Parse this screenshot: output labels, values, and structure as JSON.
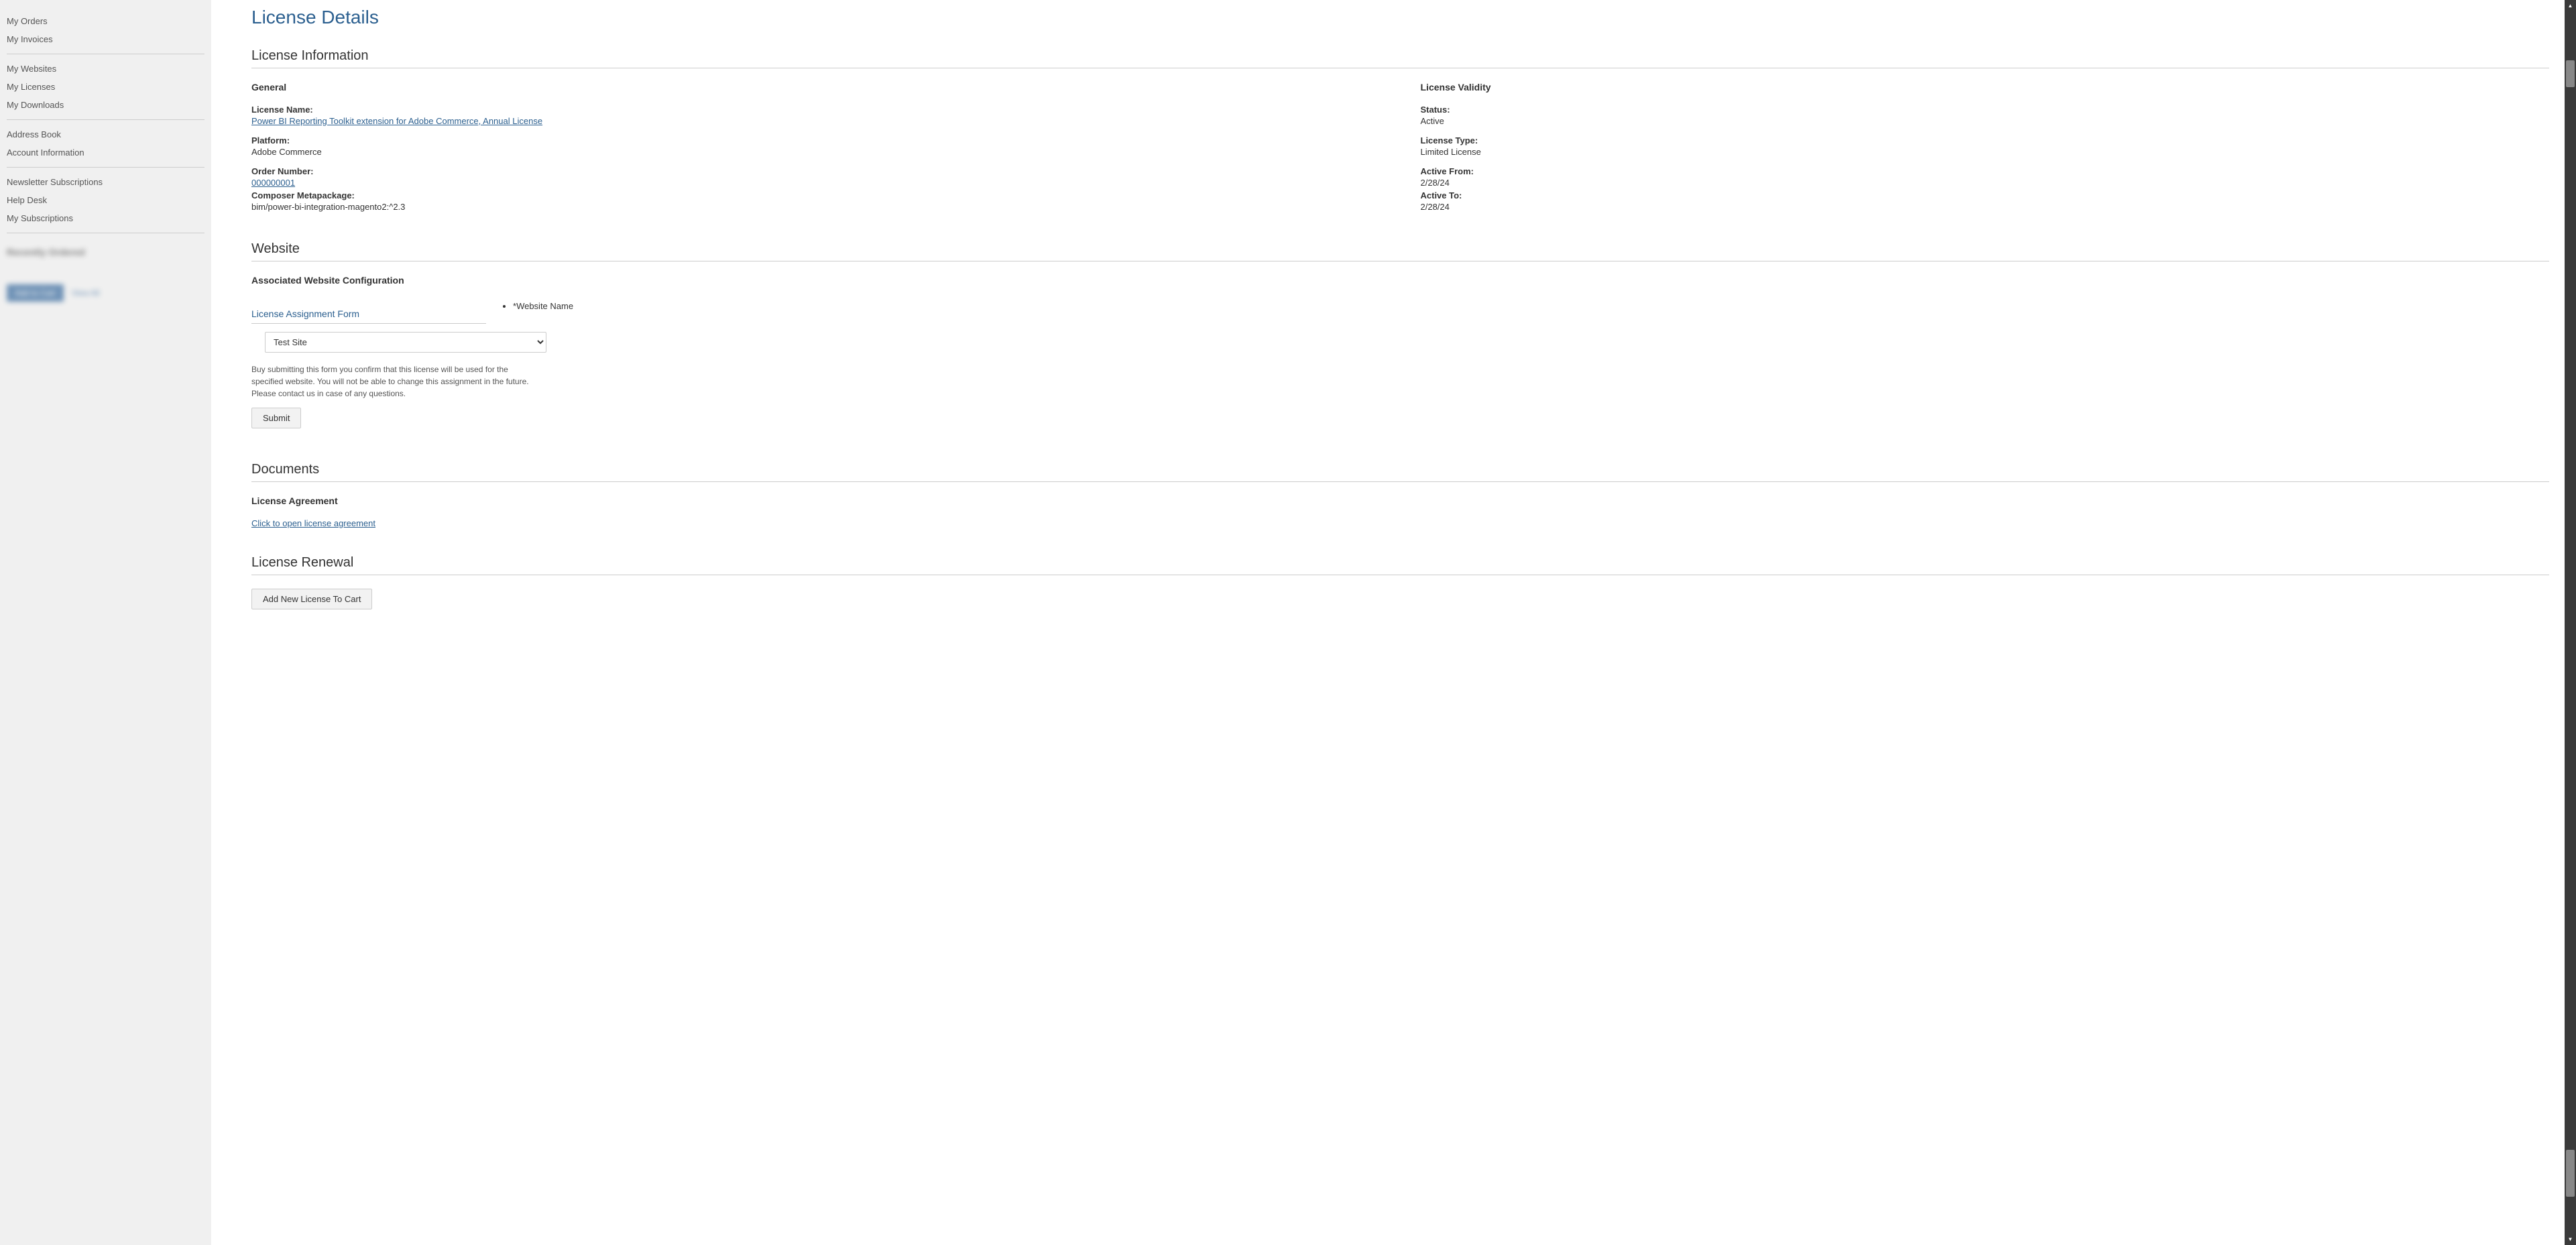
{
  "sidebar": {
    "groups": [
      {
        "items": [
          "My Orders",
          "My Invoices"
        ]
      },
      {
        "items": [
          "My Websites",
          "My Licenses",
          "My Downloads"
        ]
      },
      {
        "items": [
          "Address Book",
          "Account Information"
        ]
      },
      {
        "items": [
          "Newsletter Subscriptions",
          "Help Desk",
          "My Subscriptions"
        ]
      }
    ],
    "blurred": {
      "heading": "Recently Ordered",
      "button": "Add to Cart",
      "link": "View All"
    }
  },
  "page": {
    "title": "License Details"
  },
  "licenseInfo": {
    "sectionTitle": "License Information",
    "general": {
      "heading": "General",
      "licenseNameLabel": "License Name:",
      "licenseName": "Power BI Reporting Toolkit extension for Adobe Commerce, Annual License",
      "platformLabel": "Platform:",
      "platform": "Adobe Commerce",
      "orderNumberLabel": "Order Number:",
      "orderNumber": "000000001",
      "composerLabel": "Composer Metapackage:",
      "composer": "bim/power-bi-integration-magento2:^2.3"
    },
    "validity": {
      "heading": "License Validity",
      "statusLabel": "Status:",
      "status": "Active",
      "typeLabel": "License Type:",
      "type": "Limited License",
      "activeFromLabel": "Active From:",
      "activeFrom": "2/28/24",
      "activeToLabel": "Active To:",
      "activeTo": "2/28/24"
    }
  },
  "website": {
    "sectionTitle": "Website",
    "subheading": "Associated Website Configuration",
    "formTitle": "License Assignment Form",
    "fieldLabel": "Website Name",
    "fieldRequired": "*",
    "selected": "Test Site",
    "disclaimer": "Buy submitting this form you confirm that this license will be used for the specified website. You will not be able to change this assignment in the future. Please contact us in case of any questions.",
    "submitLabel": "Submit"
  },
  "documents": {
    "sectionTitle": "Documents",
    "subheading": "License Agreement",
    "link": "Click to open license agreement"
  },
  "renewal": {
    "sectionTitle": "License Renewal",
    "buttonLabel": "Add New License To Cart"
  }
}
